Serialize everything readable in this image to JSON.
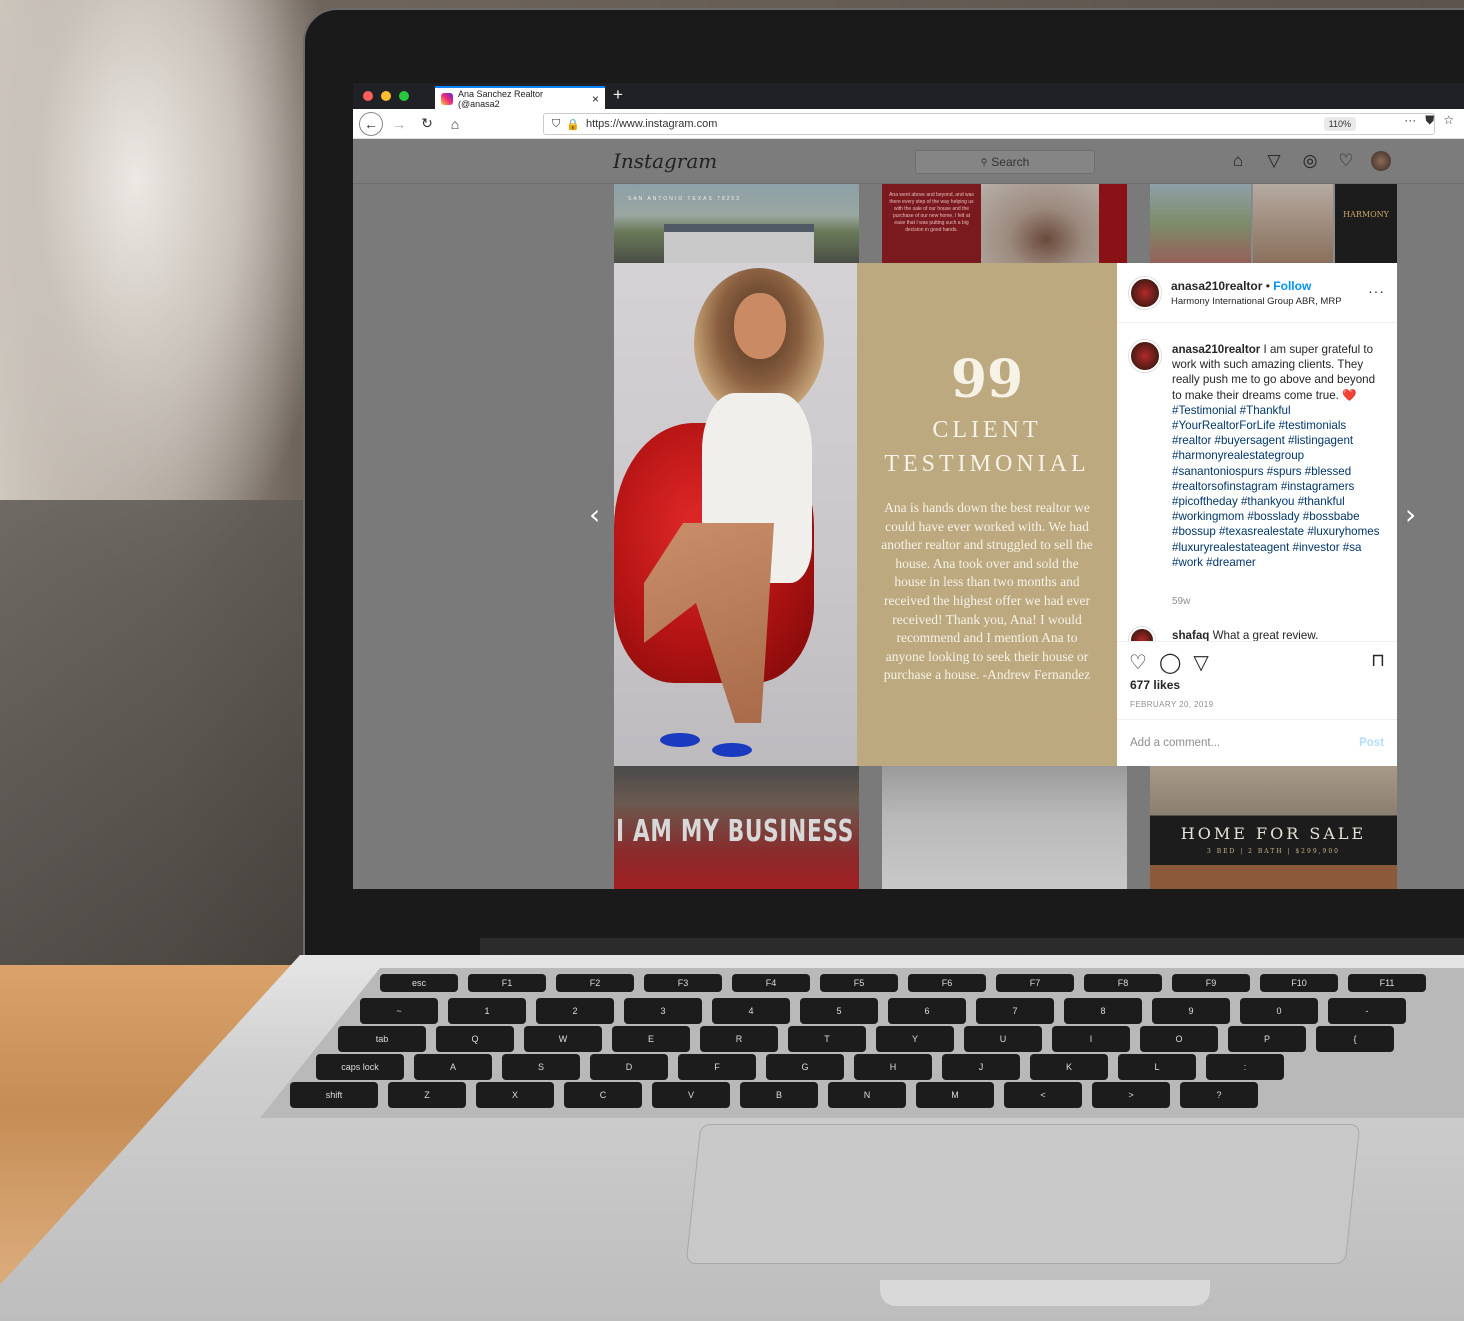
{
  "browser": {
    "tab_title": "Ana Sanchez Realtor (@anasa2",
    "url": "https://www.instagram.com",
    "zoom": "110%",
    "new_tab": "+",
    "tab_close": "×"
  },
  "instagram": {
    "logo": "Instagram",
    "search_placeholder": "Search"
  },
  "thumbnails": {
    "top_left_text": "SAN ANTONIO TEXAS 78253",
    "top_middle_text": "Ana went above and beyond, and was there every step of the way helping us with the sale of our house and the purchase of our new home. I felt at ease that I was putting such a big decision in good hands.",
    "top_right_logo": "HARMONY",
    "bottom_left_text": "I AM MY BUSINESS CARD",
    "bottom_right_title": "HOME FOR SALE",
    "bottom_right_sub": "3 BED | 2 BATH | $299,900"
  },
  "post_image": {
    "quote_mark": "99",
    "title_line1": "CLIENT",
    "title_line2": "TESTIMONIAL",
    "body": "Ana is hands down the best realtor we could have ever worked with. We had another realtor and struggled to sell the house. Ana took over and sold the house in less than two months and received the highest offer we had ever received! Thank you, Ana! I would recommend and I mention Ana to anyone looking to seek their house or purchase a house. -Andrew Fernandez"
  },
  "post": {
    "username": "anasa210realtor",
    "separator": "•",
    "follow_label": "Follow",
    "location": "Harmony International Group ABR, MRP",
    "more": "···",
    "caption_user": "anasa210realtor",
    "caption_text": "I am super grateful to work with such amazing clients. They really push me to go above and beyond to make their dreams come true. ❤️",
    "caption_tags": "#Testimonial #Thankful #YourRealtorForLife #testimonials #realtor #buyersagent #listingagent #harmonyrealestategroup #sanantoniospurs #spurs #blessed #realtorsofinstagram #instagramers #picoftheday #thankyou #thankful #workingmom #bosslady #bossbabe #bossup #texasrealestate #luxuryhomes #luxuryrealestateagent #investor #sa #work #dreamer",
    "age": "59w",
    "comment_user": "shafaq",
    "comment_text": "What a great review.",
    "likes": "677 likes",
    "date": "FEBRUARY 20, 2019",
    "comment_placeholder": "Add a comment...",
    "post_button": "Post"
  },
  "keyboard": {
    "row1": [
      "esc",
      "F1",
      "F2",
      "F3",
      "F4",
      "F5",
      "F6",
      "F7",
      "F8",
      "F9",
      "F10",
      "F11"
    ],
    "row2": [
      "~",
      "1",
      "2",
      "3",
      "4",
      "5",
      "6",
      "7",
      "8",
      "9",
      "0",
      "-"
    ],
    "row3": [
      "tab",
      "Q",
      "W",
      "E",
      "R",
      "T",
      "Y",
      "U",
      "I",
      "O",
      "P",
      "{"
    ],
    "row4": [
      "caps lock",
      "A",
      "S",
      "D",
      "F",
      "G",
      "H",
      "J",
      "K",
      "L",
      ":"
    ],
    "row5": [
      "shift",
      "Z",
      "X",
      "C",
      "V",
      "B",
      "N",
      "M",
      "<",
      ">",
      "?"
    ]
  }
}
